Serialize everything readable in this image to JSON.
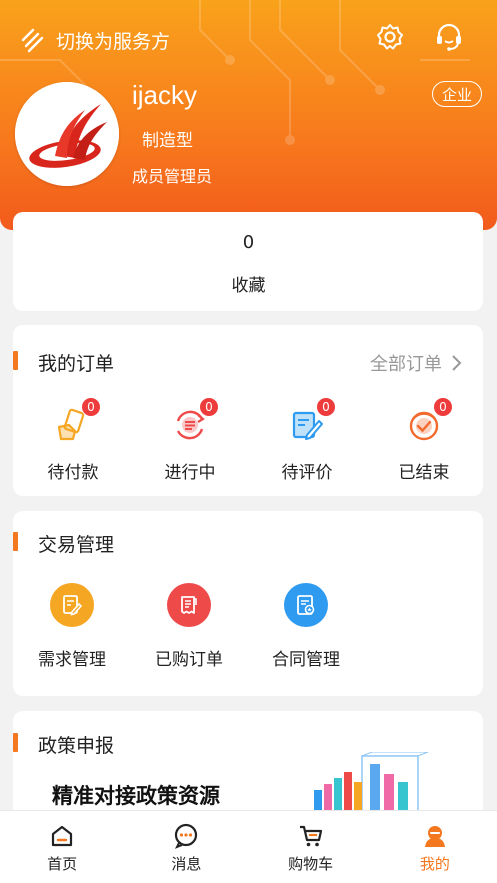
{
  "header": {
    "switch_label": "切换为服务方",
    "settings_icon": "gear-icon",
    "support_icon": "headset-icon"
  },
  "profile": {
    "username": "ijacky",
    "company_type": "制造型",
    "role": "成员管理员",
    "badge": "企业"
  },
  "favorites": {
    "count": "0",
    "label": "收藏"
  },
  "orders": {
    "title": "我的订单",
    "all_label": "全部订单",
    "items": [
      {
        "label": "待付款",
        "count": "0",
        "icon": "wallet-icon"
      },
      {
        "label": "进行中",
        "count": "0",
        "icon": "list-refresh-icon"
      },
      {
        "label": "待评价",
        "count": "0",
        "icon": "edit-document-icon"
      },
      {
        "label": "已结束",
        "count": "0",
        "icon": "check-circle-icon"
      }
    ]
  },
  "trade": {
    "title": "交易管理",
    "items": [
      {
        "label": "需求管理",
        "icon": "document-edit-icon",
        "color": "#f5a623"
      },
      {
        "label": "已购订单",
        "icon": "receipt-icon",
        "color": "#ef4a4a"
      },
      {
        "label": "合同管理",
        "icon": "contract-icon",
        "color": "#2f9bf0"
      }
    ]
  },
  "policy": {
    "title": "政策申报",
    "headline": "精准对接政策资源"
  },
  "tabbar": {
    "items": [
      {
        "label": "首页",
        "icon": "home-icon"
      },
      {
        "label": "消息",
        "icon": "message-icon"
      },
      {
        "label": "购物车",
        "icon": "cart-icon"
      },
      {
        "label": "我的",
        "icon": "user-icon"
      }
    ],
    "active_color": "#f4781f"
  },
  "colors": {
    "accent": "#f4781f",
    "header_top": "#f9a21b",
    "header_bottom": "#f25a1c",
    "badge_red": "#ee3b3b"
  }
}
